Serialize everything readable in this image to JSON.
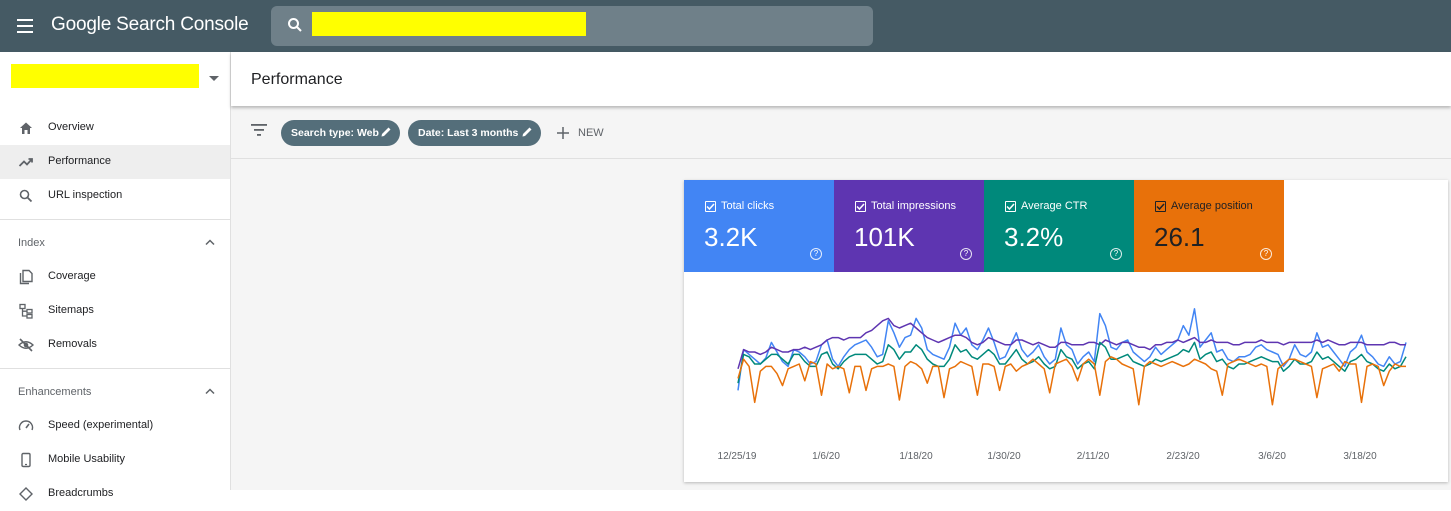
{
  "app": {
    "title": "Google Search Console"
  },
  "search": {
    "value": "",
    "placeholder": ""
  },
  "sidebar": {
    "items_top": [
      {
        "label": "Overview",
        "icon": "home-icon"
      },
      {
        "label": "Performance",
        "icon": "trending-up-icon",
        "active": true
      },
      {
        "label": "URL inspection",
        "icon": "search-icon"
      }
    ],
    "index_section": {
      "label": "Index",
      "items": [
        {
          "label": "Coverage",
          "icon": "coverage-icon"
        },
        {
          "label": "Sitemaps",
          "icon": "sitemap-icon"
        },
        {
          "label": "Removals",
          "icon": "eye-off-icon"
        }
      ]
    },
    "enhancements_section": {
      "label": "Enhancements",
      "items": [
        {
          "label": "Speed (experimental)",
          "icon": "speedometer-icon"
        },
        {
          "label": "Mobile Usability",
          "icon": "phone-icon"
        },
        {
          "label": "Breadcrumbs",
          "icon": "breadcrumb-icon"
        }
      ]
    }
  },
  "header": {
    "title": "Performance"
  },
  "filters": {
    "chips": [
      {
        "label": "Search type: Web"
      },
      {
        "label": "Date: Last 3 months"
      }
    ],
    "new_label": "NEW"
  },
  "metrics": [
    {
      "label": "Total clicks",
      "value": "3.2K",
      "color": "#4285f4",
      "checked": true
    },
    {
      "label": "Total impressions",
      "value": "101K",
      "color": "#5e35b1",
      "checked": true
    },
    {
      "label": "Average CTR",
      "value": "3.2%",
      "color": "#00897b",
      "checked": true
    },
    {
      "label": "Average position",
      "value": "26.1",
      "color": "#e8710a",
      "checked": true
    }
  ],
  "chart_data": {
    "type": "line",
    "x_tick_labels": [
      "12/25/19",
      "1/6/20",
      "1/18/20",
      "1/30/20",
      "2/11/20",
      "2/23/20",
      "3/6/20",
      "3/18/20"
    ],
    "x_range": [
      "12/22/19",
      "3/22/20"
    ],
    "y_range": [
      0,
      100
    ],
    "y_axis_shown": false,
    "grid": false,
    "legend": "none",
    "series": [
      {
        "name": "Total clicks",
        "color": "#4285f4",
        "values": [
          18,
          52,
          48,
          44,
          40,
          45,
          58,
          50,
          42,
          38,
          52,
          50,
          46,
          40,
          42,
          56,
          60,
          44,
          38,
          46,
          52,
          56,
          58,
          60,
          54,
          46,
          48,
          76,
          66,
          54,
          62,
          64,
          78,
          70,
          52,
          48,
          46,
          44,
          54,
          74,
          64,
          70,
          56,
          52,
          60,
          70,
          58,
          44,
          46,
          56,
          66,
          52,
          46,
          50,
          56,
          46,
          40,
          44,
          70,
          56,
          52,
          40,
          46,
          50,
          42,
          82,
          72,
          54,
          52,
          58,
          60,
          50,
          46,
          42,
          46,
          54,
          48,
          52,
          56,
          60,
          72,
          64,
          86,
          54,
          60,
          66,
          50,
          52,
          44,
          42,
          46,
          46,
          48,
          54,
          56,
          52,
          50,
          48,
          38,
          44,
          56,
          48,
          46,
          50,
          66,
          54,
          56,
          50,
          44,
          38,
          50,
          54,
          64,
          50,
          46,
          40,
          38,
          46,
          40,
          42,
          58
        ]
      },
      {
        "name": "Total impressions",
        "color": "#5e35b1",
        "values": [
          36,
          52,
          50,
          50,
          48,
          50,
          54,
          52,
          50,
          50,
          52,
          52,
          54,
          52,
          54,
          56,
          60,
          62,
          62,
          60,
          62,
          62,
          62,
          66,
          68,
          72,
          76,
          78,
          72,
          70,
          72,
          74,
          70,
          66,
          62,
          60,
          58,
          60,
          62,
          64,
          64,
          62,
          58,
          56,
          58,
          62,
          60,
          58,
          56,
          56,
          60,
          60,
          58,
          56,
          58,
          56,
          54,
          54,
          58,
          58,
          56,
          56,
          56,
          58,
          58,
          56,
          60,
          58,
          56,
          58,
          58,
          56,
          54,
          54,
          52,
          56,
          56,
          58,
          58,
          60,
          58,
          60,
          62,
          58,
          58,
          60,
          58,
          58,
          58,
          56,
          56,
          58,
          58,
          58,
          60,
          58,
          58,
          58,
          56,
          58,
          58,
          58,
          58,
          58,
          60,
          58,
          60,
          58,
          56,
          56,
          58,
          58,
          58,
          56,
          56,
          56,
          56,
          58,
          58,
          56,
          56
        ]
      },
      {
        "name": "Average CTR",
        "color": "#00897b",
        "values": [
          24,
          48,
          46,
          40,
          40,
          44,
          48,
          48,
          44,
          40,
          48,
          48,
          42,
          38,
          38,
          48,
          50,
          40,
          36,
          42,
          46,
          48,
          48,
          48,
          44,
          40,
          42,
          56,
          52,
          44,
          50,
          50,
          56,
          52,
          44,
          40,
          38,
          38,
          44,
          56,
          50,
          52,
          46,
          44,
          48,
          52,
          48,
          40,
          40,
          46,
          52,
          44,
          40,
          42,
          46,
          40,
          36,
          38,
          52,
          46,
          44,
          36,
          40,
          42,
          36,
          58,
          54,
          44,
          44,
          46,
          48,
          42,
          40,
          38,
          40,
          44,
          42,
          44,
          46,
          48,
          52,
          50,
          58,
          44,
          48,
          50,
          42,
          44,
          38,
          36,
          40,
          40,
          42,
          44,
          46,
          44,
          42,
          42,
          34,
          38,
          44,
          40,
          40,
          42,
          50,
          44,
          46,
          42,
          38,
          34,
          42,
          44,
          48,
          42,
          40,
          36,
          34,
          40,
          36,
          38,
          46
        ]
      },
      {
        "name": "Average position",
        "color": "#e8710a",
        "values": [
          28,
          44,
          38,
          8,
          34,
          38,
          38,
          32,
          22,
          36,
          38,
          40,
          26,
          42,
          40,
          14,
          40,
          36,
          38,
          36,
          16,
          38,
          38,
          18,
          36,
          38,
          38,
          40,
          38,
          10,
          38,
          42,
          40,
          36,
          24,
          38,
          38,
          12,
          36,
          38,
          42,
          40,
          38,
          14,
          40,
          40,
          38,
          18,
          38,
          40,
          34,
          38,
          40,
          44,
          40,
          36,
          16,
          40,
          42,
          44,
          38,
          26,
          40,
          44,
          40,
          14,
          42,
          46,
          44,
          40,
          38,
          36,
          6,
          38,
          42,
          40,
          38,
          40,
          42,
          40,
          38,
          40,
          44,
          42,
          40,
          36,
          34,
          14,
          40,
          42,
          44,
          42,
          40,
          38,
          40,
          38,
          6,
          36,
          40,
          44,
          44,
          42,
          40,
          38,
          12,
          36,
          38,
          40,
          34,
          42,
          40,
          40,
          8,
          38,
          40,
          38,
          22,
          34,
          40,
          38,
          38
        ]
      }
    ]
  }
}
